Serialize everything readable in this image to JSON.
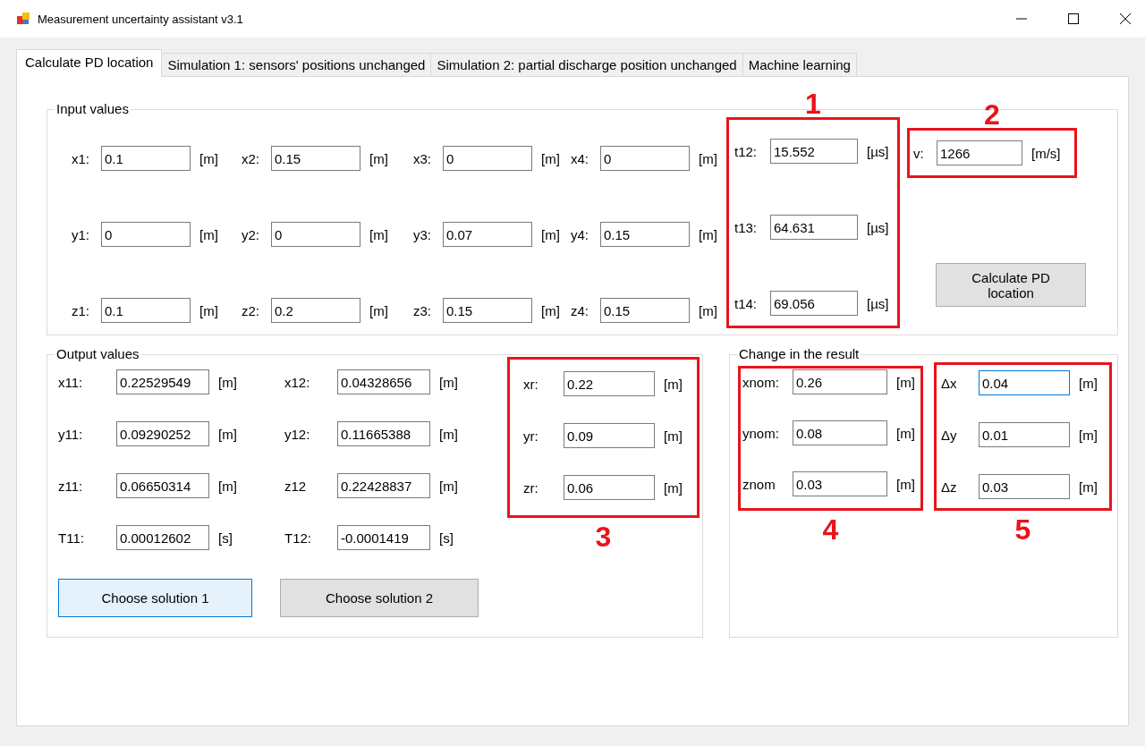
{
  "window": {
    "title": "Measurement uncertainty assistant v3.1"
  },
  "tabs": [
    {
      "label": "Calculate PD location",
      "selected": true
    },
    {
      "label": "Simulation 1: sensors' positions unchanged",
      "selected": false
    },
    {
      "label": "Simulation 2: partial discharge position unchanged",
      "selected": false
    },
    {
      "label": "Machine learning",
      "selected": false
    }
  ],
  "input_values": {
    "title": "Input values",
    "coordinates": [
      [
        {
          "label": "x1:",
          "value": "0.1",
          "unit": "[m]"
        },
        {
          "label": "y1:",
          "value": "0",
          "unit": "[m]"
        },
        {
          "label": "z1:",
          "value": "0.1",
          "unit": "[m]"
        }
      ],
      [
        {
          "label": "x2:",
          "value": "0.15",
          "unit": "[m]"
        },
        {
          "label": "y2:",
          "value": "0",
          "unit": "[m]"
        },
        {
          "label": "z2:",
          "value": "0.2",
          "unit": "[m]"
        }
      ],
      [
        {
          "label": "x3:",
          "value": "0",
          "unit": "[m]"
        },
        {
          "label": "y3:",
          "value": "0.07",
          "unit": "[m]"
        },
        {
          "label": "z3:",
          "value": "0.15",
          "unit": "[m]"
        }
      ],
      [
        {
          "label": "x4:",
          "value": "0",
          "unit": "[m]"
        },
        {
          "label": "y4:",
          "value": "0.15",
          "unit": "[m]"
        },
        {
          "label": "z4:",
          "value": "0.15",
          "unit": "[m]"
        }
      ]
    ],
    "times": {
      "annotation": "1",
      "number_above": true,
      "fields": [
        {
          "label": "t12:",
          "value": "15.552",
          "unit": "[µs]"
        },
        {
          "label": "t13:",
          "value": "64.631",
          "unit": "[µs]"
        },
        {
          "label": "t14:",
          "value": "69.056",
          "unit": "[µs]"
        }
      ]
    },
    "speed": {
      "annotation": "2",
      "number_above": true,
      "field": {
        "label": "v:",
        "value": "1266",
        "unit": "[m/s]"
      }
    },
    "calculate_button": "Calculate PD location"
  },
  "output_values": {
    "title": "Output values",
    "solutions": [
      [
        {
          "label": "x11:",
          "value": "0.22529549",
          "unit": "[m]"
        },
        {
          "label": "y11:",
          "value": "0.09290252",
          "unit": "[m]"
        },
        {
          "label": "z11:",
          "value": "0.06650314",
          "unit": "[m]"
        },
        {
          "label": "T11:",
          "value": "0.00012602",
          "unit": "[s]"
        }
      ],
      [
        {
          "label": "x12:",
          "value": "0.04328656",
          "unit": "[m]"
        },
        {
          "label": "y12:",
          "value": "0.11665388",
          "unit": "[m]"
        },
        {
          "label": "z12",
          "value": "0.22428837",
          "unit": "[m]"
        },
        {
          "label": "T12:",
          "value": "-0.0001419",
          "unit": "[s]"
        }
      ]
    ],
    "result": {
      "annotation": "3",
      "number_above": false,
      "fields": [
        {
          "label": "xr:",
          "value": "0.22",
          "unit": "[m]"
        },
        {
          "label": "yr:",
          "value": "0.09",
          "unit": "[m]"
        },
        {
          "label": "zr:",
          "value": "0.06",
          "unit": "[m]"
        }
      ]
    },
    "buttons": [
      {
        "label": "Choose solution 1",
        "default": true
      },
      {
        "label": "Choose solution 2",
        "default": false
      }
    ]
  },
  "change_in_result": {
    "title": "Change in the result",
    "nominal": {
      "annotation": "4",
      "number_above": false,
      "fields": [
        {
          "label": "xnom:",
          "value": "0.26",
          "unit": "[m]"
        },
        {
          "label": "ynom:",
          "value": "0.08",
          "unit": "[m]"
        },
        {
          "label": "znom",
          "value": "0.03",
          "unit": "[m]"
        }
      ]
    },
    "deltas": {
      "annotation": "5",
      "number_above": false,
      "fields": [
        {
          "label": "Δx",
          "value": "0.04",
          "unit": "[m]",
          "focused": true
        },
        {
          "label": "Δy",
          "value": "0.01",
          "unit": "[m]",
          "focused": false
        },
        {
          "label": "Δz",
          "value": "0.03",
          "unit": "[m]",
          "focused": false
        }
      ]
    }
  }
}
